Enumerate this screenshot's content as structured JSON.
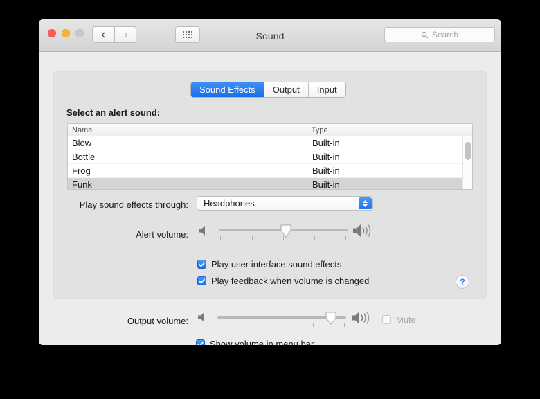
{
  "window": {
    "title": "Sound",
    "traffic_lights": [
      "close",
      "minimize",
      "zoom"
    ],
    "nav": {
      "back": "back-chevron",
      "forward": "forward-chevron"
    },
    "show_all_icon": "grid-icon",
    "search": {
      "placeholder": "Search",
      "value": "",
      "icon": "search-icon"
    }
  },
  "tabs": [
    {
      "label": "Sound Effects",
      "active": true
    },
    {
      "label": "Output",
      "active": false
    },
    {
      "label": "Input",
      "active": false
    }
  ],
  "alert_sounds": {
    "section_label": "Select an alert sound:",
    "columns": [
      "Name",
      "Type"
    ],
    "rows": [
      {
        "name": "Blow",
        "type": "Built-in",
        "selected": false
      },
      {
        "name": "Bottle",
        "type": "Built-in",
        "selected": false
      },
      {
        "name": "Frog",
        "type": "Built-in",
        "selected": false
      },
      {
        "name": "Funk",
        "type": "Built-in",
        "selected": true
      }
    ],
    "scrollbar": "vertical-scrollbar"
  },
  "output_device": {
    "label": "Play sound effects through:",
    "selected": "Headphones"
  },
  "alert_volume": {
    "label": "Alert volume:",
    "value_percent": 52,
    "min_icon": "speaker-quiet-icon",
    "max_icon": "speaker-loud-icon",
    "tick_count": 5
  },
  "options": [
    {
      "label": "Play user interface sound effects",
      "checked": true
    },
    {
      "label": "Play feedback when volume is changed",
      "checked": true
    }
  ],
  "help": {
    "label": "?",
    "icon": "help-icon"
  },
  "output_volume": {
    "label": "Output volume:",
    "value_percent": 88,
    "min_icon": "speaker-quiet-icon",
    "max_icon": "speaker-loud-icon",
    "tick_count": 5,
    "mute": {
      "label": "Mute",
      "checked": false,
      "disabled": true
    }
  },
  "menu_bar_option": {
    "label": "Show volume in menu bar",
    "checked": true
  },
  "colors": {
    "accent_blue": "#1f73ea",
    "window_bg": "#ececec",
    "groupbox_bg": "#e2e2e2",
    "selected_row": "#d4d4d4"
  }
}
